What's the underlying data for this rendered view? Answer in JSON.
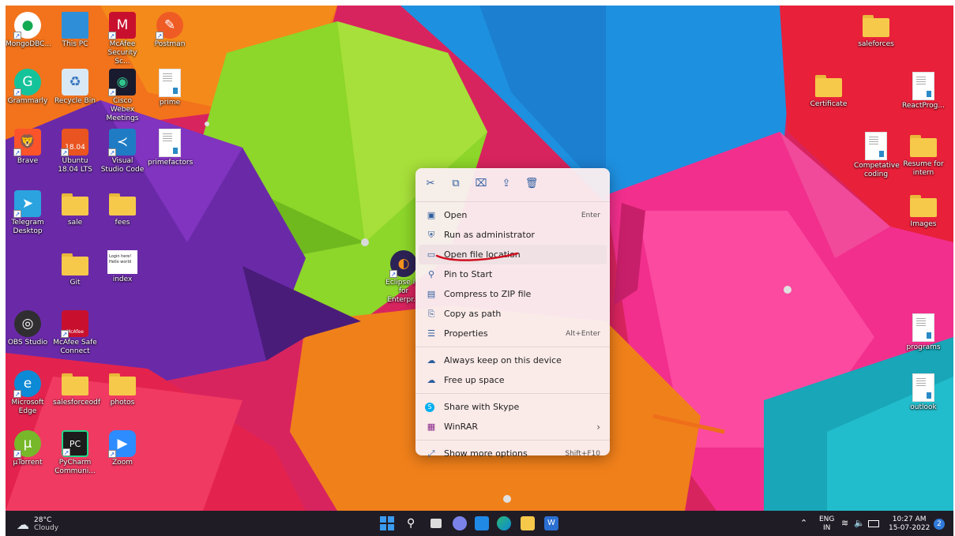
{
  "desktop_icons": [
    {
      "label": "MongoDBC...",
      "icon": "mongodb-icon",
      "color": "#ffffff"
    },
    {
      "label": "This PC",
      "icon": "monitor-icon",
      "color": "#2e8fd8"
    },
    {
      "label": "McAfee Security Sc...",
      "icon": "mcafee-shield-icon",
      "color": "#c8102e"
    },
    {
      "label": "Postman",
      "icon": "postman-icon",
      "color": "#ef5b25"
    },
    {
      "label": "Grammarly",
      "icon": "grammarly-icon",
      "color": "#15c39a"
    },
    {
      "label": "Recycle Bin",
      "icon": "recycle-bin-icon",
      "color": "#d9e8f5"
    },
    {
      "label": "Cisco Webex Meetings",
      "icon": "webex-icon",
      "color": "#1a1a2e"
    },
    {
      "label": "prime",
      "icon": "document-icon",
      "color": "#ffffff"
    },
    {
      "label": "Brave",
      "icon": "brave-icon",
      "color": "#fb542b"
    },
    {
      "label": "Ubuntu 18.04 LTS",
      "icon": "ubuntu-icon",
      "color": "#e95420"
    },
    {
      "label": "Visual Studio Code",
      "icon": "vscode-icon",
      "color": "#1f7cc4"
    },
    {
      "label": "primefactors",
      "icon": "document-icon",
      "color": "#ffffff"
    },
    {
      "label": "Telegram Desktop",
      "icon": "telegram-icon",
      "color": "#2aa3df"
    },
    {
      "label": "sale",
      "icon": "folder-icon",
      "color": "#f6c94b"
    },
    {
      "label": "fees",
      "icon": "folder-icon",
      "color": "#f6c94b"
    },
    {
      "label": "Git",
      "icon": "folder-icon",
      "color": "#f6c94b"
    },
    {
      "label": "index",
      "icon": "html-file-icon",
      "color": "#ffffff"
    },
    {
      "label": "OBS Studio",
      "icon": "obs-icon",
      "color": "#302e31"
    },
    {
      "label": "McAfee Safe Connect",
      "icon": "mcafee-safe-connect-icon",
      "color": "#c8102e"
    },
    {
      "label": "Microsoft Edge",
      "icon": "edge-icon",
      "color": "#0c8ad6"
    },
    {
      "label": "salesforceodf",
      "icon": "folder-icon",
      "color": "#f6c94b"
    },
    {
      "label": "photos",
      "icon": "folder-icon",
      "color": "#f6c94b"
    },
    {
      "label": "µTorrent",
      "icon": "utorrent-icon",
      "color": "#77b82a"
    },
    {
      "label": "PyCharm Communi...",
      "icon": "pycharm-icon",
      "color": "#1c1c1c"
    },
    {
      "label": "Zoom",
      "icon": "zoom-icon",
      "color": "#2d8cff"
    },
    {
      "label": "Eclipse I... for Enterpr...",
      "icon": "eclipse-icon",
      "color": "#2c2255"
    },
    {
      "label": "saleforces",
      "icon": "folder-icon",
      "color": "#f6c94b"
    },
    {
      "label": "Certificate",
      "icon": "folder-icon",
      "color": "#f6c94b"
    },
    {
      "label": "ReactProg...",
      "icon": "document-icon",
      "color": "#ffffff"
    },
    {
      "label": "Competative coding",
      "icon": "document-icon",
      "color": "#ffffff"
    },
    {
      "label": "Resume for intern",
      "icon": "folder-icon",
      "color": "#f6c94b"
    },
    {
      "label": "Images",
      "icon": "folder-icon",
      "color": "#f6c94b"
    },
    {
      "label": "programs",
      "icon": "document-icon",
      "color": "#ffffff"
    },
    {
      "label": "outlook",
      "icon": "document-icon",
      "color": "#ffffff"
    }
  ],
  "icon_badges": {
    "ubuntu": "18.04",
    "mcafee_safe": "McAfee",
    "pycharm": "PC",
    "index_preview_1": "Login here!",
    "index_preview_2": "Hello world"
  },
  "context_menu": {
    "toolbar": [
      {
        "icon": "cut-icon",
        "glyph": "✂"
      },
      {
        "icon": "copy-icon",
        "glyph": "⧉"
      },
      {
        "icon": "rename-icon",
        "glyph": "⌧"
      },
      {
        "icon": "share-icon",
        "glyph": "⇪"
      },
      {
        "icon": "delete-icon",
        "glyph": "🗑"
      }
    ],
    "items": [
      {
        "label": "Open",
        "shortcut": "Enter",
        "icon": "open-icon",
        "glyph": "▣"
      },
      {
        "label": "Run as administrator",
        "shortcut": "",
        "icon": "shield-icon",
        "glyph": "⛨"
      },
      {
        "label": "Open file location",
        "shortcut": "",
        "icon": "folder-icon",
        "glyph": "▭"
      },
      {
        "label": "Pin to Start",
        "shortcut": "",
        "icon": "pin-icon",
        "glyph": "⚲"
      },
      {
        "label": "Compress to ZIP file",
        "shortcut": "",
        "icon": "zip-icon",
        "glyph": "▤"
      },
      {
        "label": "Copy as path",
        "shortcut": "",
        "icon": "path-icon",
        "glyph": "⎘"
      },
      {
        "label": "Properties",
        "shortcut": "Alt+Enter",
        "icon": "properties-icon",
        "glyph": "☰"
      },
      {
        "label": "Always keep on this device",
        "shortcut": "",
        "icon": "cloud-sync-icon",
        "glyph": "☁"
      },
      {
        "label": "Free up space",
        "shortcut": "",
        "icon": "cloud-icon",
        "glyph": "☁"
      },
      {
        "label": "Share with Skype",
        "shortcut": "",
        "icon": "skype-icon",
        "glyph": "S"
      },
      {
        "label": "WinRAR",
        "shortcut": "›",
        "icon": "winrar-icon",
        "glyph": "▦"
      },
      {
        "label": "Show more options",
        "shortcut": "Shift+F10",
        "icon": "more-options-icon",
        "glyph": "⤢"
      }
    ],
    "annotation_color": "#d01020"
  },
  "taskbar": {
    "weather_temp": "28°C",
    "weather_desc": "Cloudy",
    "apps": [
      {
        "icon": "windows-start-icon",
        "color": "#3a9bf0"
      },
      {
        "icon": "search-icon",
        "color": "#ffffff"
      },
      {
        "icon": "task-view-icon",
        "color": "#dddddd"
      },
      {
        "icon": "teams-chat-icon",
        "color": "#7b83eb"
      },
      {
        "icon": "mail-icon",
        "color": "#1f89e5"
      },
      {
        "icon": "edge-icon",
        "color": "#2bb673"
      },
      {
        "icon": "file-explorer-icon",
        "color": "#f6c94b"
      },
      {
        "icon": "word-icon",
        "color": "#2b6fd1"
      }
    ],
    "lang_top": "ENG",
    "lang_bottom": "IN",
    "time": "10:27 AM",
    "date": "15-07-2022",
    "notification_count": "2"
  }
}
